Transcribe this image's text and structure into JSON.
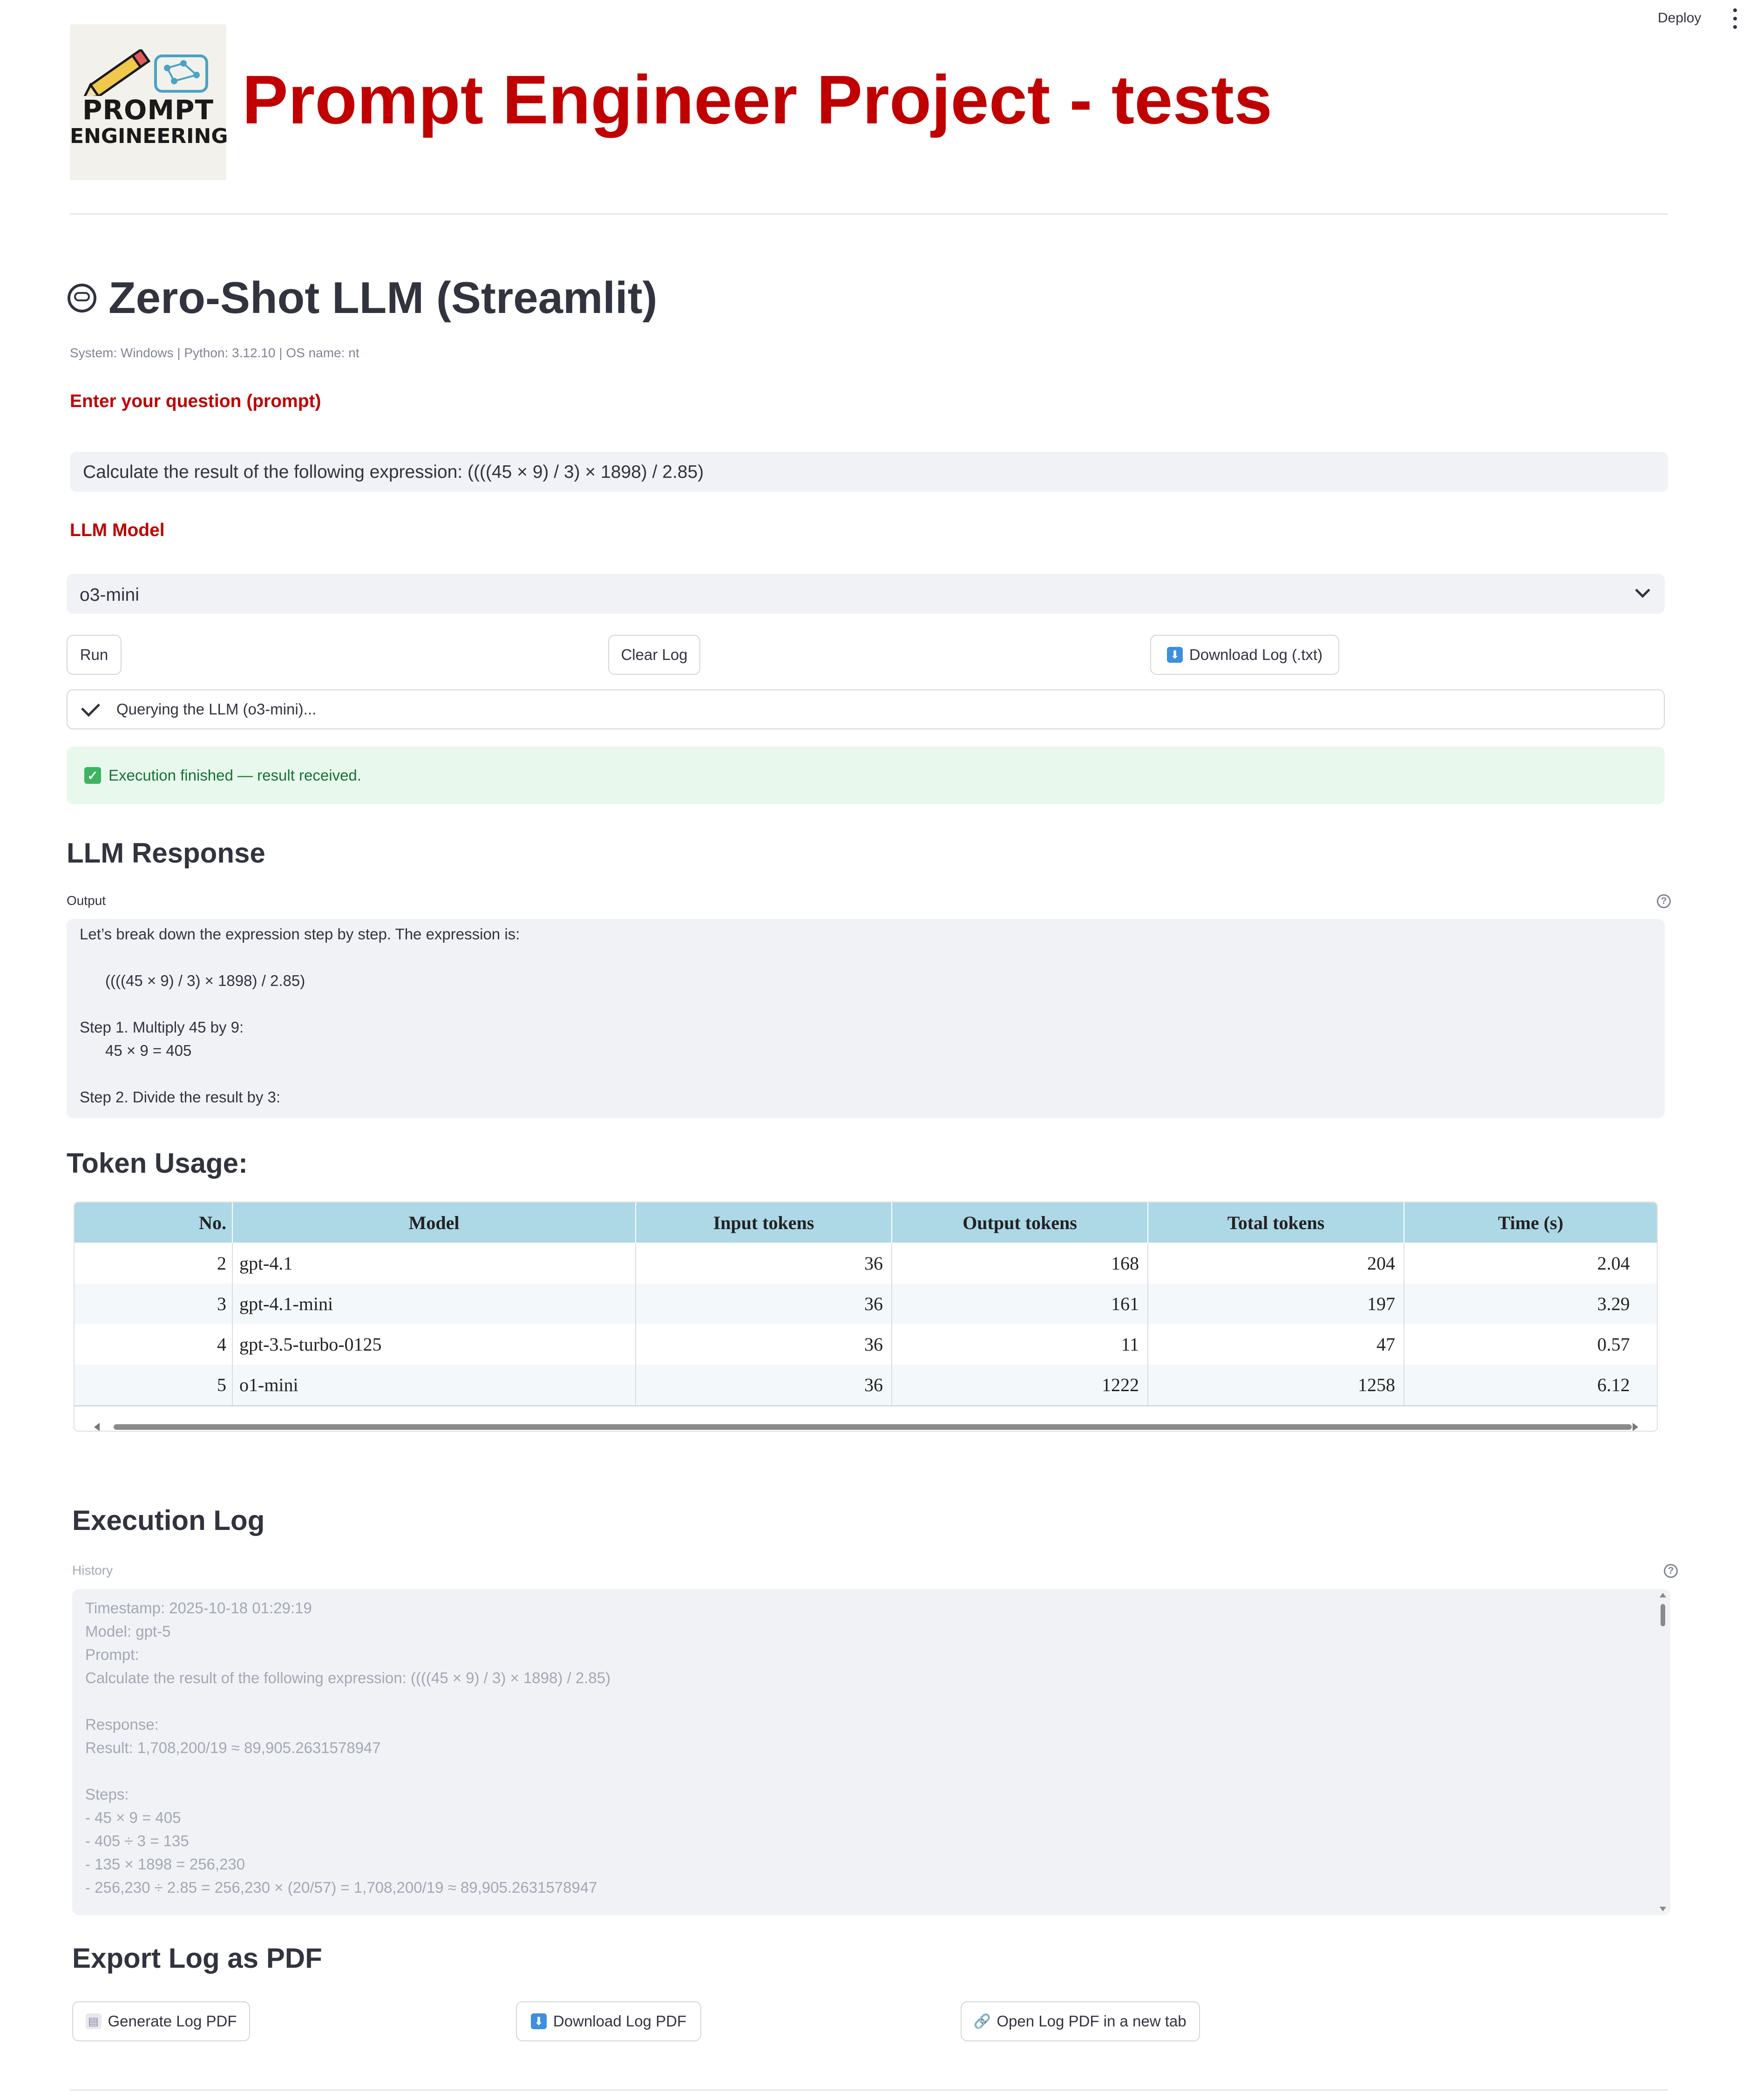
{
  "toolbar": {
    "deploy_label": "Deploy"
  },
  "header": {
    "logo_text_1": "PROMPT",
    "logo_text_2": "ENGINEERING",
    "title": "Prompt Engineer Project - tests"
  },
  "main": {
    "heading": "Zero-Shot LLM (Streamlit)",
    "system_info": "System: Windows | Python: 3.12.10 | OS name: nt",
    "prompt_label": "Enter your question (prompt)",
    "prompt_value": "Calculate the result of the following expression: ((((45 × 9) / 3) × 1898) / 2.85)",
    "model_label": "LLM Model",
    "model_value": "o3-mini",
    "buttons": {
      "run": "Run",
      "clear_log": "Clear Log",
      "download_log": "Download Log (.txt)"
    },
    "status_text": "Querying the LLM (o3-mini)...",
    "success_text": "Execution finished — result received."
  },
  "response": {
    "heading": "LLM Response",
    "output_label": "Output",
    "lines": [
      "Let’s break down the expression step by step. The expression is:",
      "",
      "      ((((45 × 9) / 3) × 1898) / 2.85)",
      "",
      "Step 1. Multiply 45 by 9:",
      "      45 × 9 = 405",
      "",
      "Step 2. Divide the result by 3:"
    ]
  },
  "tokens": {
    "heading": "Token Usage:",
    "columns": [
      "No.",
      "Model",
      "Input tokens",
      "Output tokens",
      "Total tokens",
      "Time (s)"
    ],
    "rows": [
      [
        "2",
        "gpt-4.1",
        "36",
        "168",
        "204",
        "2.04"
      ],
      [
        "3",
        "gpt-4.1-mini",
        "36",
        "161",
        "197",
        "3.29"
      ],
      [
        "4",
        "gpt-3.5-turbo-0125",
        "36",
        "11",
        "47",
        "0.57"
      ],
      [
        "5",
        "o1-mini",
        "36",
        "1222",
        "1258",
        "6.12"
      ]
    ]
  },
  "log": {
    "heading": "Execution Log",
    "history_label": "History",
    "lines": [
      "Timestamp: 2025-10-18 01:29:19",
      "Model: gpt-5",
      "Prompt:",
      "Calculate the result of the following expression: ((((45 × 9) / 3) × 1898) / 2.85)",
      "",
      "Response:",
      "Result: 1,708,200/19 ≈ 89,905.2631578947",
      "",
      "Steps:",
      "- 45 × 9 = 405",
      "- 405 ÷ 3 = 135",
      "- 135 × 1898 = 256,230",
      "- 256,230 ÷ 2.85 = 256,230 × (20/57) = 1,708,200/19 ≈ 89,905.2631578947"
    ]
  },
  "export": {
    "heading": "Export Log as PDF",
    "generate": "Generate Log PDF",
    "download": "Download Log PDF",
    "open": "Open Log PDF in a new tab"
  },
  "icons": [
    "kebab-menu-icon",
    "robot-icon",
    "chevron-down-icon",
    "download-icon",
    "check-icon",
    "success-check-icon",
    "help-icon",
    "document-icon",
    "link-icon"
  ]
}
